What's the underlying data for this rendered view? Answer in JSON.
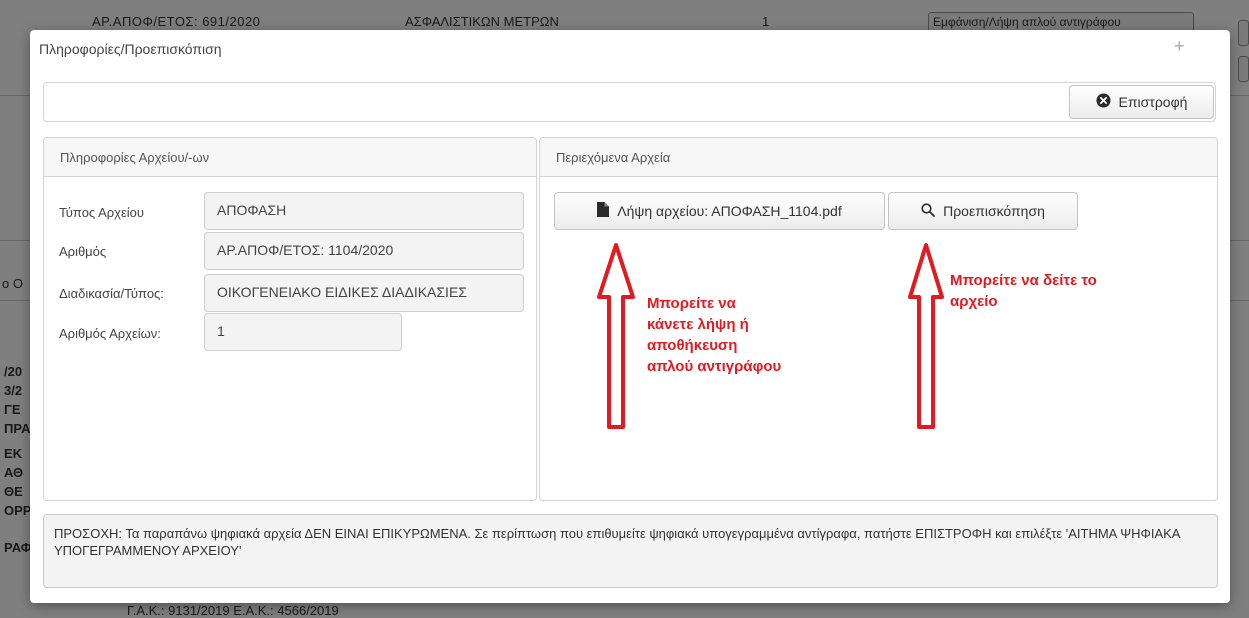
{
  "background": {
    "row_top_text_1": "ΑΡ.ΑΠΟΦ/ΕΤΟΣ: 691/2020",
    "row_top_text_2": "ΑΣΦΑΛΙΣΤΙΚΩΝ ΜΕΤΡΩΝ",
    "row_top_number": "1",
    "row_top_button": "Εμφάνιση/Λήψη απλού αντιγράφου",
    "side_fragments": [
      "/20",
      "3/2",
      "ΓΕ",
      "ΠΡΑ",
      "ΕΚ",
      "ΑΘ",
      "ΘΕ",
      "ΟΡΡ",
      "ΡΑΦ"
    ],
    "left_fragment": "ο Ο",
    "bottom_text": "Γ.Α.Κ.: 9131/2019 Ε.Α.Κ.: 4566/2019"
  },
  "modal": {
    "title": "Πληροφορίες/Προεπισκόπιση",
    "back_button": "Επιστροφή",
    "left_panel": {
      "header": "Πληροφορίες Αρχείου/-ων",
      "fields": [
        {
          "label": "Τύπος Αρχείου",
          "value": "ΑΠΟΦΑΣΗ"
        },
        {
          "label": "Αριθμός",
          "value": "ΑΡ.ΑΠΟΦ/ΕΤΟΣ: 1104/2020"
        },
        {
          "label": "Διαδικασία/Τύπος:",
          "value": "ΟΙΚΟΓΕΝΕΙΑΚΟ ΕΙΔΙΚΕΣ ΔΙΑΔΙΚΑΣΙΕΣ"
        },
        {
          "label": "Αριθμός Αρχείων:",
          "value": "1"
        }
      ]
    },
    "right_panel": {
      "header": "Περιεχόμενα Αρχεία",
      "download_button": "Λήψη αρχείου: ΑΠΟΦΑΣΗ_1104.pdf",
      "preview_button": "Προεπισκόπηση"
    },
    "annotations": {
      "download_note": [
        "Μπορείτε να",
        "κάνετε λήψη ή",
        "αποθήκευση",
        "απλού αντιγράφου"
      ],
      "preview_note": [
        "Μπορείτε να δείτε το",
        "αρχείο"
      ],
      "color": "#e21a22"
    },
    "notice": "ΠΡΟΣΟΧΗ: Τα παραπάνω ψηφιακά αρχεία ΔΕΝ ΕΙΝΑΙ ΕΠΙΚΥΡΩΜΕΝΑ. Σε περίπτωση που επιθυμείτε ψηφιακά υπογεγραμμένα αντίγραφα, πατήστε ΕΠΙΣΤΡΟΦΗ και επιλέξτε 'ΑΙΤΗΜΑ ΨΗΦΙΑΚΑ ΥΠΟΓΕΓΡΑΜΜΕΝΟΥ ΑΡΧΕΙΟΥ'"
  },
  "icons": {
    "close_icon": "plus-icon",
    "back_icon": "circle-x-icon",
    "file_icon": "file-icon",
    "search_icon": "search-icon"
  }
}
